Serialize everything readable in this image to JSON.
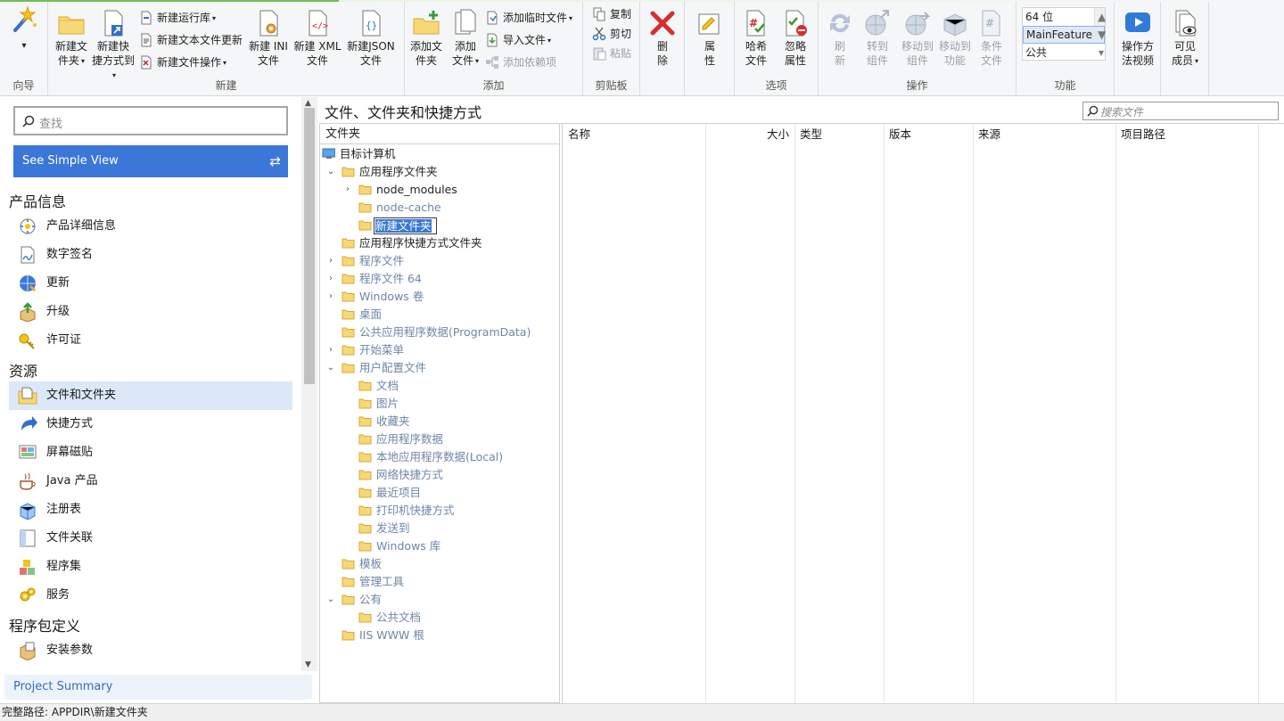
{
  "colors": {
    "accent": "#3b77d8",
    "selection": "#dbe8f8",
    "topline": "#6fbf52",
    "folder": "#f8d775",
    "folder_edge": "#d8a93a"
  },
  "ribbon": {
    "groups": {
      "wizard": "向导",
      "new": "新建",
      "add": "添加",
      "clipboard": "剪贴板",
      "options": "选项",
      "actions": "操作",
      "features": "功能"
    },
    "wizard_caret": "▾",
    "new_folder": [
      "新建文",
      "件夹"
    ],
    "new_shortcut": [
      "新建快",
      "捷方式到"
    ],
    "new_run_library": "新建运行库",
    "new_text_update": "新建文本文件更新",
    "new_file_op": "新建文件操作",
    "new_ini": [
      "新建 INI",
      "文件"
    ],
    "new_xml": [
      "新建 XML",
      "文件"
    ],
    "new_json": [
      "新建JSON",
      "文件"
    ],
    "add_folder": [
      "添加文",
      "件夹"
    ],
    "add_file": [
      "添加",
      "文件"
    ],
    "add_temp_file": "添加临时文件",
    "import_file": "导入文件",
    "add_dependency": "添加依赖项",
    "copy": "复制",
    "cut": "剪切",
    "paste": "粘贴",
    "delete": [
      "删",
      "除"
    ],
    "properties": [
      "属",
      "性"
    ],
    "hash_file": [
      "哈希",
      "文件"
    ],
    "ignore_attr": [
      "忽略",
      "属性"
    ],
    "refresh": [
      "刷",
      "新"
    ],
    "go_component": [
      "转到",
      "组件"
    ],
    "move_component": [
      "移动到",
      "组件"
    ],
    "move_feature": [
      "移动到",
      "功能"
    ],
    "cond_file": [
      "条件",
      "文件"
    ],
    "arch_options": [
      "64 位",
      "MainFeature",
      "公共"
    ],
    "how_to_video": [
      "操作方",
      "法视频"
    ],
    "visible_members": [
      "可见",
      "成员"
    ]
  },
  "left": {
    "search_placeholder": "查找",
    "simple_view": "See Simple View",
    "sections": [
      {
        "title": "产品信息",
        "items": [
          {
            "label": "产品详细信息",
            "icon": "product-details-icon"
          },
          {
            "label": "数字签名",
            "icon": "digital-signature-icon"
          },
          {
            "label": "更新",
            "icon": "update-icon"
          },
          {
            "label": "升级",
            "icon": "upgrade-icon"
          },
          {
            "label": "许可证",
            "icon": "license-icon"
          }
        ]
      },
      {
        "title": "资源",
        "items": [
          {
            "label": "文件和文件夹",
            "icon": "files-folders-icon",
            "active": true
          },
          {
            "label": "快捷方式",
            "icon": "shortcut-icon"
          },
          {
            "label": "屏幕磁贴",
            "icon": "screen-tile-icon"
          },
          {
            "label": "Java 产品",
            "icon": "java-icon"
          },
          {
            "label": "注册表",
            "icon": "registry-icon"
          },
          {
            "label": "文件关联",
            "icon": "file-association-icon"
          },
          {
            "label": "程序集",
            "icon": "assembly-icon"
          },
          {
            "label": "服务",
            "icon": "service-icon"
          }
        ]
      },
      {
        "title": "程序包定义",
        "items": [
          {
            "label": "安装参数",
            "icon": "install-params-icon"
          }
        ]
      }
    ],
    "project_summary": "Project Summary"
  },
  "main": {
    "title": "文件、文件夹和快捷方式",
    "search_placeholder": "搜索文件",
    "tree_header": "文件夹",
    "tree": [
      {
        "label": "目标计算机",
        "level": 0,
        "type": "computer"
      },
      {
        "label": "应用程序文件夹",
        "level": 1,
        "expand": "open"
      },
      {
        "label": "node_modules",
        "level": 2,
        "expand": "closed"
      },
      {
        "label": "node-cache",
        "level": 2,
        "dim": true
      },
      {
        "label": "新建文件夹",
        "level": 2,
        "editing": true
      },
      {
        "label": "应用程序快捷方式文件夹",
        "level": 1
      },
      {
        "label": "程序文件",
        "level": 1,
        "expand": "closed",
        "dim": true
      },
      {
        "label": "程序文件 64",
        "level": 1,
        "expand": "closed",
        "dim": true
      },
      {
        "label": "Windows 卷",
        "level": 1,
        "expand": "closed",
        "dim": true
      },
      {
        "label": "桌面",
        "level": 1,
        "dim": true
      },
      {
        "label": "公共应用程序数据(ProgramData)",
        "level": 1,
        "dim": true
      },
      {
        "label": "开始菜单",
        "level": 1,
        "expand": "closed",
        "dim": true
      },
      {
        "label": "用户配置文件",
        "level": 1,
        "expand": "open",
        "dim": true
      },
      {
        "label": "文档",
        "level": 2,
        "dim": true
      },
      {
        "label": "图片",
        "level": 2,
        "dim": true
      },
      {
        "label": "收藏夹",
        "level": 2,
        "dim": true
      },
      {
        "label": "应用程序数据",
        "level": 2,
        "dim": true
      },
      {
        "label": "本地应用程序数据(Local)",
        "level": 2,
        "dim": true
      },
      {
        "label": "网络快捷方式",
        "level": 2,
        "dim": true
      },
      {
        "label": "最近项目",
        "level": 2,
        "dim": true
      },
      {
        "label": "打印机快捷方式",
        "level": 2,
        "dim": true
      },
      {
        "label": "发送到",
        "level": 2,
        "dim": true
      },
      {
        "label": "Windows 库",
        "level": 2,
        "dim": true
      },
      {
        "label": "模板",
        "level": 1,
        "dim": true
      },
      {
        "label": "管理工具",
        "level": 1,
        "dim": true
      },
      {
        "label": "公有",
        "level": 1,
        "expand": "open",
        "dim": true
      },
      {
        "label": "公共文档",
        "level": 2,
        "dim": true
      },
      {
        "label": "IIS WWW 根",
        "level": 1,
        "dim": true
      }
    ],
    "columns": [
      "名称",
      "大小",
      "类型",
      "版本",
      "来源",
      "项目路径"
    ]
  },
  "status": {
    "path": "完整路径: APPDIR\\新建文件夹"
  }
}
